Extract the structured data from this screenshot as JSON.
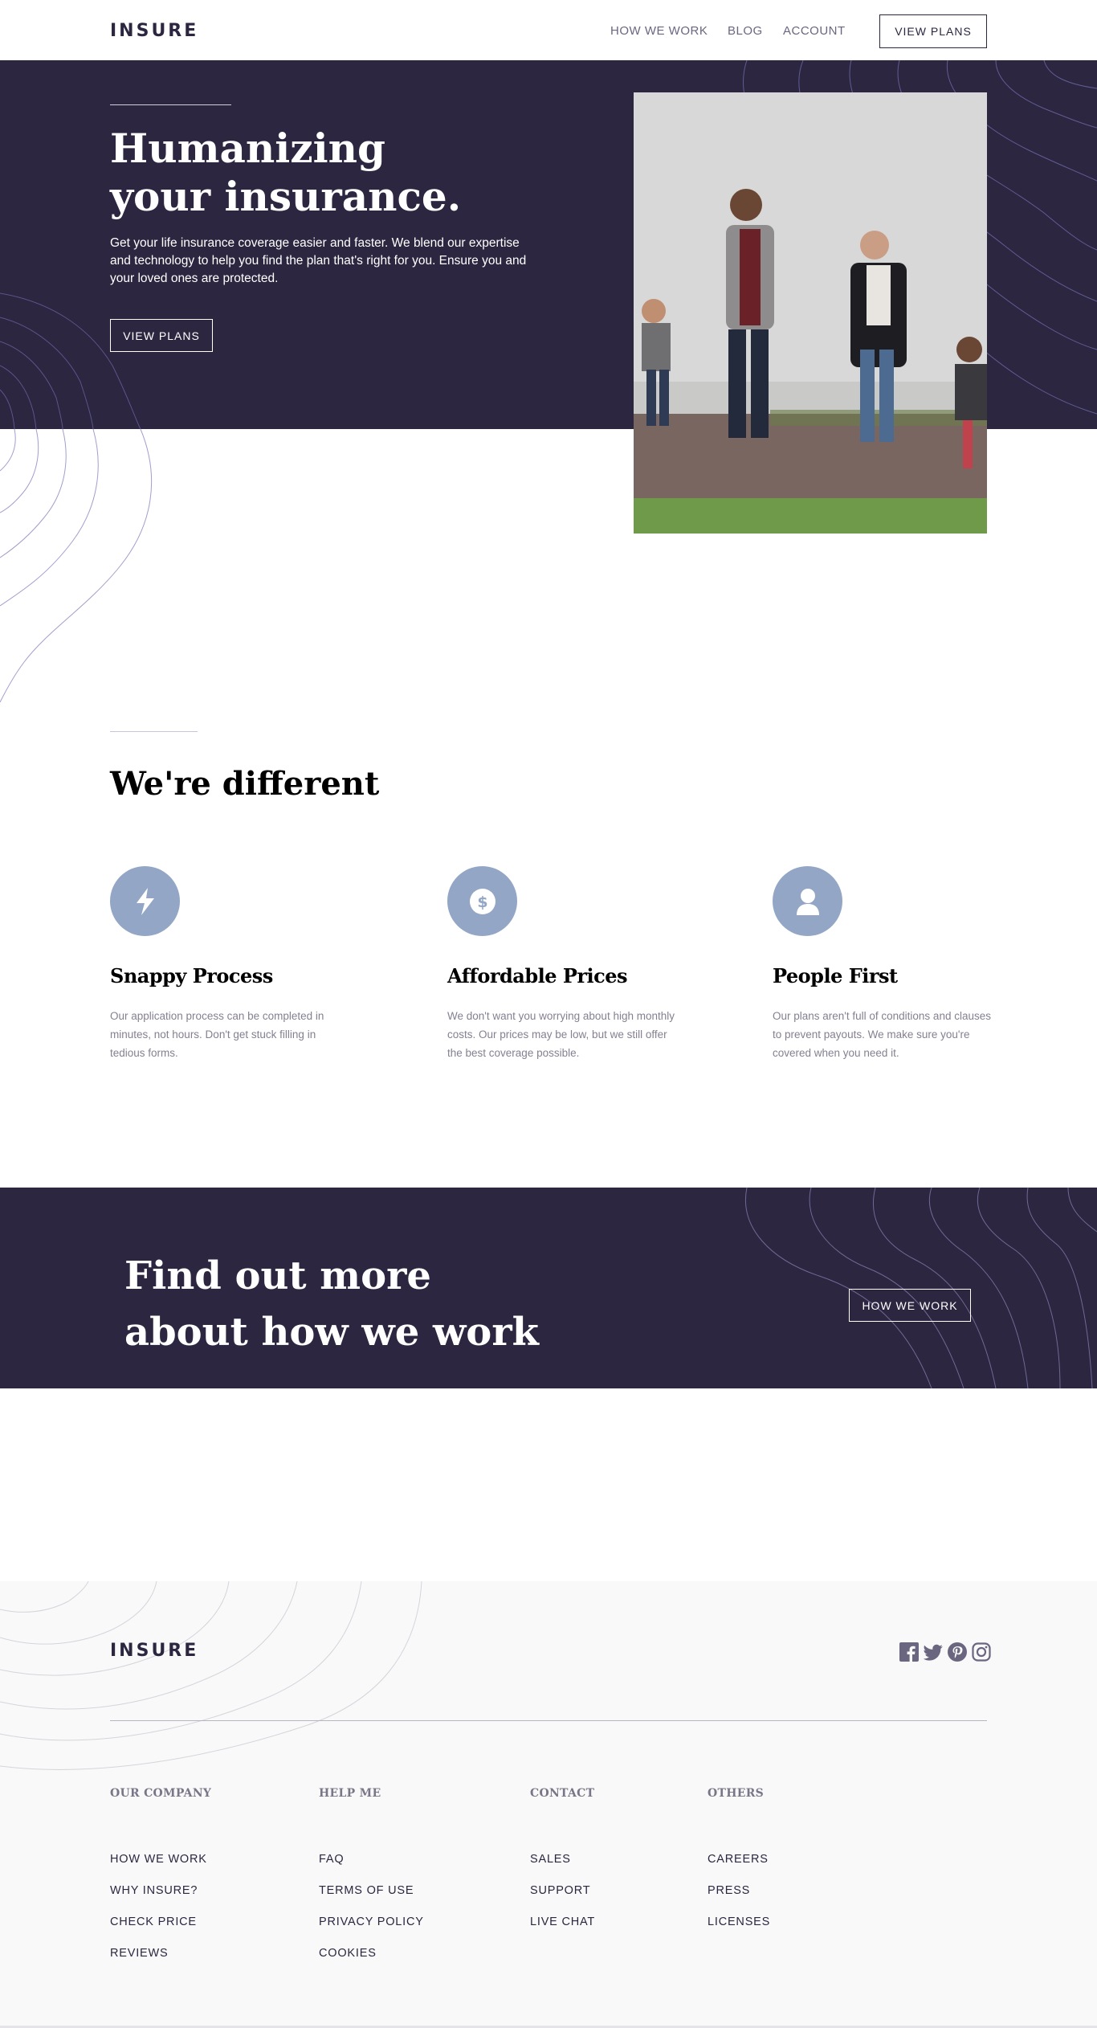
{
  "header": {
    "logo": "INSURE",
    "nav": [
      {
        "label": "HOW WE WORK"
      },
      {
        "label": "BLOG"
      },
      {
        "label": "ACCOUNT"
      }
    ],
    "cta_label": "VIEW PLANS"
  },
  "hero": {
    "title_line1": "Humanizing",
    "title_line2": "your insurance.",
    "text": "Get your life insurance coverage easier and faster. We blend our expertise and technology to help you find the plan that's right for you. Ensure you and your loved ones are protected.",
    "button_label": "VIEW PLANS"
  },
  "different": {
    "title": "We're different",
    "features": [
      {
        "icon": "lightning-icon",
        "title": "Snappy Process",
        "text": "Our application process can be completed in minutes, not hours. Don't get stuck filling in tedious forms."
      },
      {
        "icon": "dollar-coin-icon",
        "title": "Affordable Prices",
        "text": "We don't want you worrying about high monthly costs. Our prices may be low, but we still offer the best coverage possible."
      },
      {
        "icon": "person-icon",
        "title": "People First",
        "text": "Our plans aren't full of conditions and clauses to prevent payouts. We make sure you're covered when you need it."
      }
    ]
  },
  "cta": {
    "title_line1": "Find out more",
    "title_line2": "about how we work",
    "button_label": "HOW WE WORK"
  },
  "footer": {
    "logo": "INSURE",
    "social": [
      "facebook-icon",
      "twitter-icon",
      "pinterest-icon",
      "instagram-icon"
    ],
    "columns": [
      {
        "heading": "OUR COMPANY",
        "links": [
          "HOW WE WORK",
          "WHY INSURE?",
          "CHECK PRICE",
          "REVIEWS"
        ]
      },
      {
        "heading": "HELP ME",
        "links": [
          "FAQ",
          "TERMS OF USE",
          "PRIVACY POLICY",
          "COOKIES"
        ]
      },
      {
        "heading": "CONTACT",
        "links": [
          "SALES",
          "SUPPORT",
          "LIVE CHAT"
        ]
      },
      {
        "heading": "OTHERS",
        "links": [
          "CAREERS",
          "PRESS",
          "LICENSES"
        ]
      }
    ]
  },
  "colors": {
    "dark_violet": "#2c2640",
    "icon_blue": "#93a6c5",
    "footer_bg": "#f9f9f9"
  }
}
